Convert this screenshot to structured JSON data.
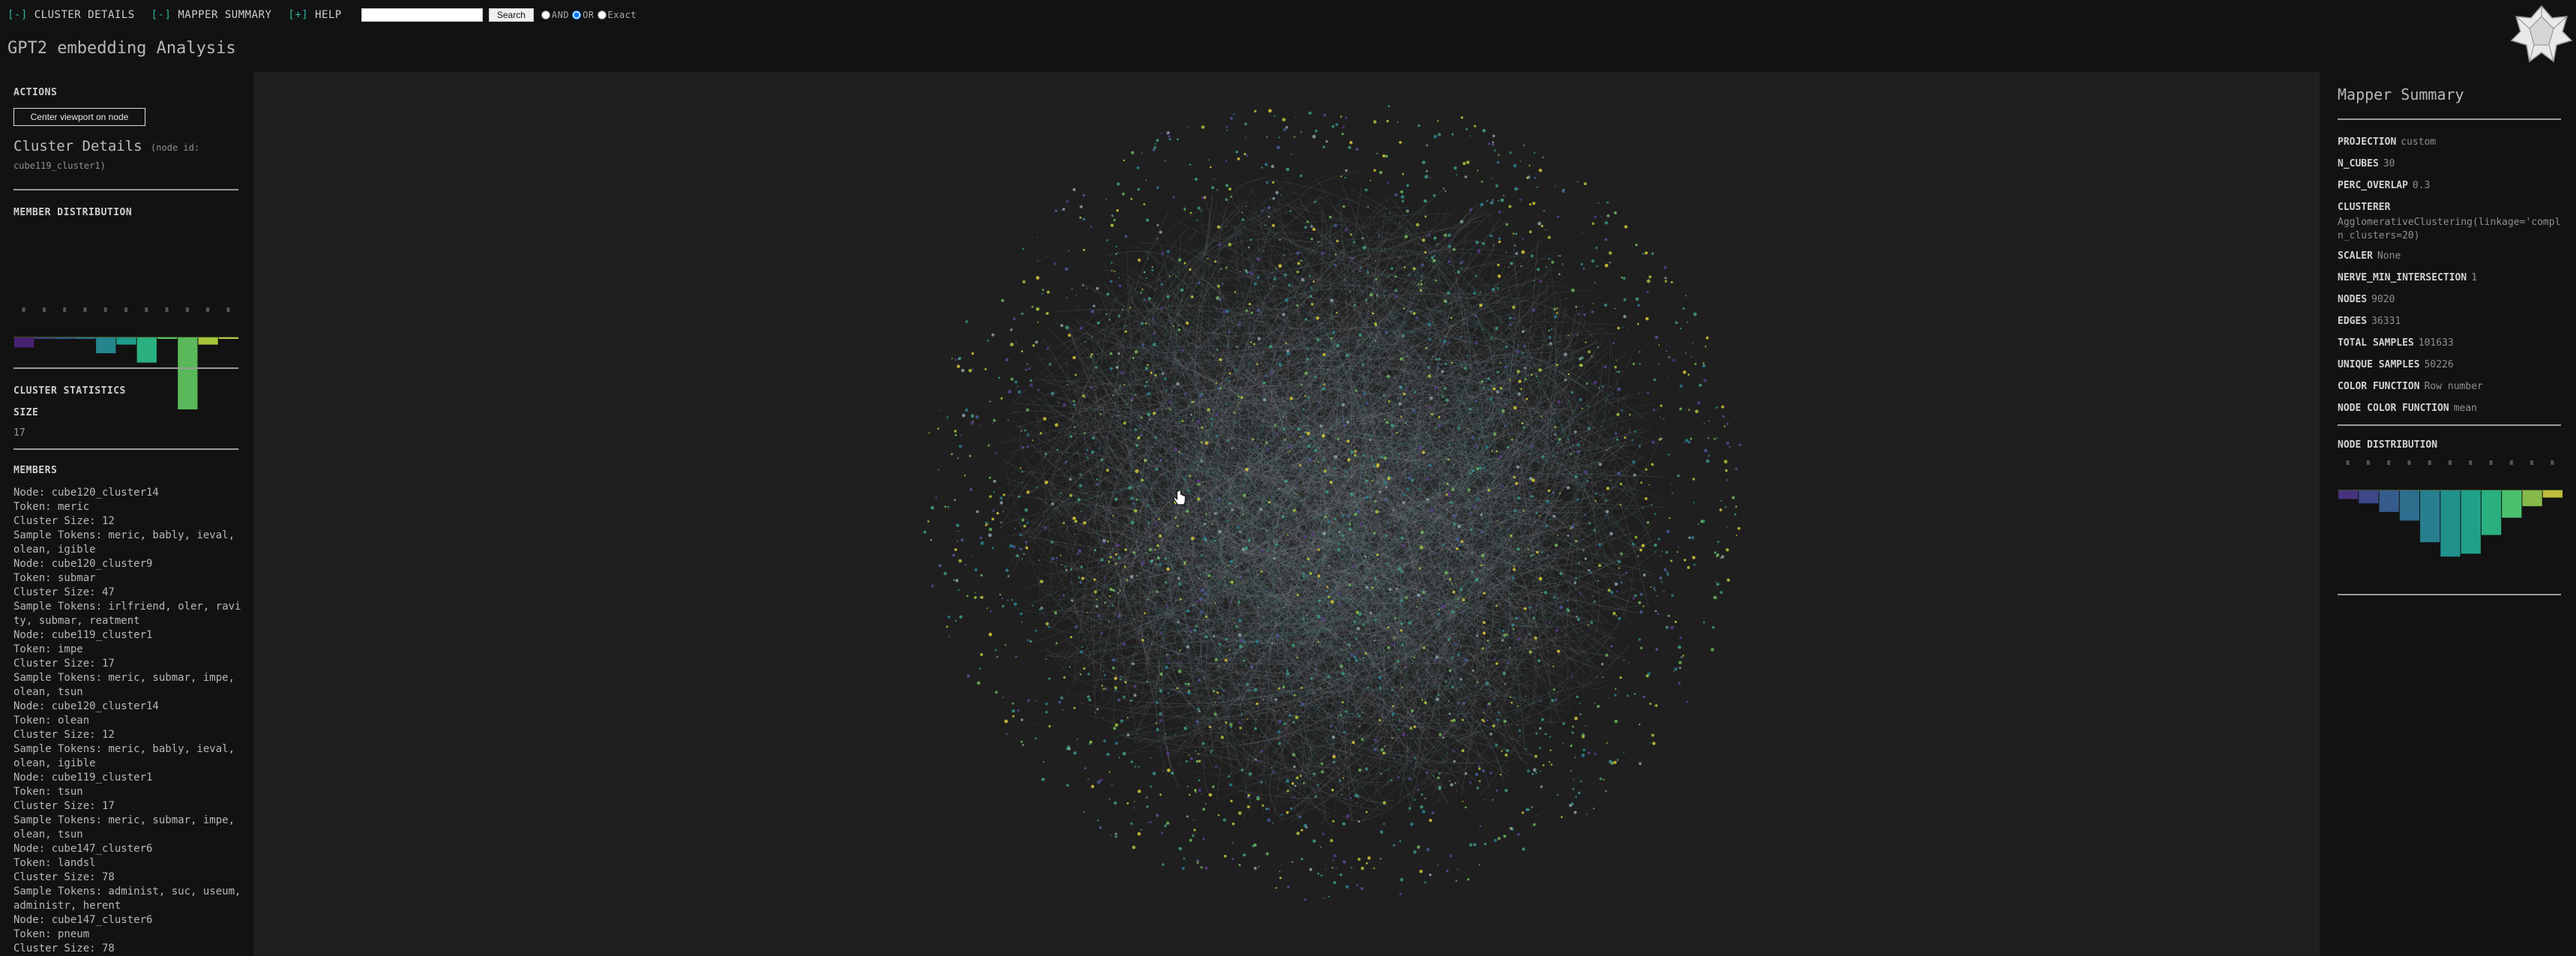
{
  "menu": {
    "cluster_details": {
      "bracket": "[-]",
      "label": " CLUSTER DETAILS"
    },
    "mapper_summary": {
      "bracket": "[-]",
      "label": " MAPPER SUMMARY"
    },
    "help": {
      "bracket": "[+]",
      "label": " HELP"
    }
  },
  "search": {
    "placeholder": "",
    "value": "",
    "button_label": "Search"
  },
  "search_mode": {
    "options": [
      {
        "label": "AND",
        "checked": false
      },
      {
        "label": "OR",
        "checked": true
      },
      {
        "label": "Exact",
        "checked": false
      }
    ]
  },
  "page_title": "GPT2 embedding Analysis",
  "left_panel": {
    "actions_heading": "ACTIONS",
    "center_button_label": "Center viewport on node",
    "cluster_details_title": "Cluster Details",
    "cluster_details_sub_1": "(node id:",
    "cluster_details_sub_2": "cube119_cluster1)",
    "member_distribution_heading": "MEMBER DISTRIBUTION",
    "member_distribution": {
      "bars": [
        {
          "value": 0.14,
          "color": "#482173"
        },
        {
          "value": 0.0,
          "color": "#433e85"
        },
        {
          "value": 0.0,
          "color": "#38588c"
        },
        {
          "value": 0.0,
          "color": "#2d708e"
        },
        {
          "value": 0.22,
          "color": "#25858e"
        },
        {
          "value": 0.1,
          "color": "#1e9b8a"
        },
        {
          "value": 0.35,
          "color": "#2ab07f"
        },
        {
          "value": 0.0,
          "color": "#52c569"
        },
        {
          "value": 1.0,
          "color": "#5ab75a"
        },
        {
          "value": 0.1,
          "color": "#a5c33a"
        },
        {
          "value": 0.02,
          "color": "#c0c44a"
        }
      ]
    },
    "cluster_statistics_heading": "CLUSTER STATISTICS",
    "size_label": "SIZE",
    "size_value": "17",
    "members_heading": "MEMBERS",
    "members_text": "Node: cube120_cluster14\nToken: meric\nCluster Size: 12\nSample Tokens: meric, bably, ieval, olean, igible\nNode: cube120_cluster9\nToken: submar\nCluster Size: 47\nSample Tokens: irlfriend, oler, ravity, submar, reatment\nNode: cube119_cluster1\nToken: impe\nCluster Size: 17\nSample Tokens: meric, submar, impe, olean, tsun\nNode: cube120_cluster14\nToken: olean\nCluster Size: 12\nSample Tokens: meric, bably, ieval, olean, igible\nNode: cube119_cluster1\nToken: tsun\nCluster Size: 17\nSample Tokens: meric, submar, impe, olean, tsun\nNode: cube147_cluster6\nToken: landsl\nCluster Size: 78\nSample Tokens: administ, suc, useum, administr, herent\nNode: cube147_cluster6\nToken: pneum\nCluster Size: 78"
  },
  "mapper_summary": {
    "title": "Mapper Summary",
    "stats": [
      {
        "key": "PROJECTION",
        "value": "custom"
      },
      {
        "key": "N_CUBES",
        "value": "30"
      },
      {
        "key": "PERC_OVERLAP",
        "value": "0.3"
      },
      {
        "key": "CLUSTERER",
        "value": ""
      }
    ],
    "clusterer_value": "AgglomerativeClustering(linkage='compl\nn_clusters=20)",
    "stats2": [
      {
        "key": "SCALER",
        "value": "None"
      },
      {
        "key": "NERVE_MIN_INTERSECTION",
        "value": "1"
      },
      {
        "key": "NODES",
        "value": "9020"
      },
      {
        "key": "EDGES",
        "value": "36331"
      },
      {
        "key": "TOTAL SAMPLES",
        "value": "101633"
      },
      {
        "key": "UNIQUE SAMPLES",
        "value": "50226"
      },
      {
        "key": "COLOR FUNCTION",
        "value": "Row number"
      },
      {
        "key": "NODE COLOR FUNCTION",
        "value": "mean"
      }
    ],
    "node_distribution_heading": "NODE DISTRIBUTION",
    "node_distribution": {
      "bars": [
        {
          "value": 0.12,
          "color": "#46327e"
        },
        {
          "value": 0.18,
          "color": "#3f4889"
        },
        {
          "value": 0.3,
          "color": "#365c8d"
        },
        {
          "value": 0.42,
          "color": "#2e6f8e"
        },
        {
          "value": 0.72,
          "color": "#277f8e"
        },
        {
          "value": 0.92,
          "color": "#21918c"
        },
        {
          "value": 0.88,
          "color": "#1fa187"
        },
        {
          "value": 0.62,
          "color": "#2ab07f"
        },
        {
          "value": 0.38,
          "color": "#4ac16d"
        },
        {
          "value": 0.22,
          "color": "#86b94a"
        },
        {
          "value": 0.1,
          "color": "#bdbd3a"
        }
      ]
    }
  },
  "graph": {
    "description_name": "mapper-graph-visualization"
  }
}
